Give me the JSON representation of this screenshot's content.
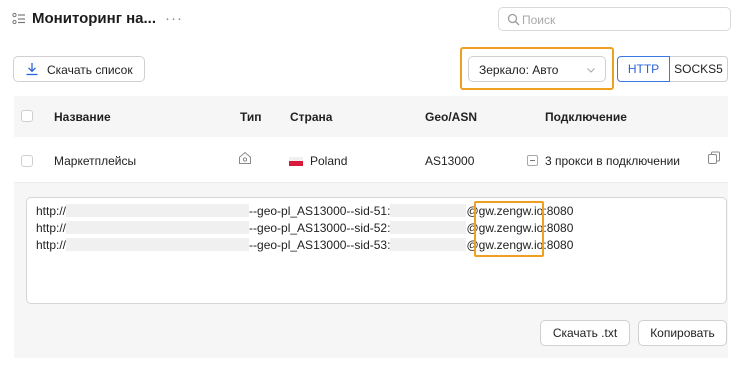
{
  "header": {
    "title": "Мониторинг на...",
    "more": "···",
    "search_placeholder": "Поиск"
  },
  "toolbar": {
    "download_list": "Скачать список",
    "mirror_select": "Зеркало: Авто",
    "protocols": [
      "HTTP",
      "SOCKS5"
    ],
    "active_protocol": "HTTP"
  },
  "table": {
    "columns": [
      "Название",
      "Тип",
      "Страна",
      "Geo/ASN",
      "Подключение"
    ],
    "rows": [
      {
        "name": "Маркетплейсы",
        "country": "Poland",
        "geo_asn": "AS13000",
        "connection": "3 прокси в подключении"
      }
    ]
  },
  "proxies": {
    "lines": [
      {
        "scheme": "http://",
        "middle": "--geo-pl_AS13000--sid-51:",
        "at": "@",
        "host": "gw.zengw.io",
        "port": ":8080"
      },
      {
        "scheme": "http://",
        "middle": "--geo-pl_AS13000--sid-52:",
        "at": "@",
        "host": "gw.zengw.io",
        "port": ":8080"
      },
      {
        "scheme": "http://",
        "middle": "--geo-pl_AS13000--sid-53:",
        "at": "@",
        "host": "gw.zengw.io",
        "port": ":8080"
      }
    ],
    "download_txt": "Скачать .txt",
    "copy": "Копировать"
  },
  "colors": {
    "accent": "#2a63d9",
    "highlight": "#f0a020",
    "flag_red": "#d91a3a"
  },
  "icons": [
    "list-icon",
    "search-icon",
    "download-icon",
    "chevron-down-icon",
    "home-type-icon",
    "poland-flag-icon",
    "minus-square-icon",
    "copy-icon"
  ]
}
